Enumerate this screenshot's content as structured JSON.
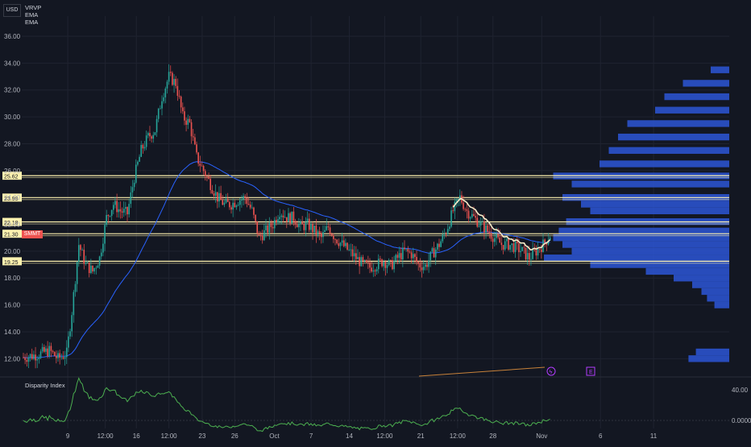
{
  "top_bar": {
    "currency": "USD"
  },
  "indicators": [
    "VRVP",
    "EMA",
    "EMA"
  ],
  "sub_pane": {
    "title": "Disparity Index",
    "ticks": [
      "40.00",
      "0.0000"
    ]
  },
  "colors": {
    "bg": "#131722",
    "grid": "#1f2330",
    "up": "#26a69a",
    "down": "#ef5350",
    "ema_long": "#2962ff",
    "ema_short": "#f5ecc9",
    "level": "#fff3b0",
    "profile": "#2d56d6",
    "disparity_up": "#4caf50",
    "disparity_down": "#ef5350",
    "trend": "#c8823a",
    "event": "#b33cff"
  },
  "badges": {
    "ticker": "SMMT",
    "lightning": "ϟ",
    "earnings": "E"
  },
  "y_axis": {
    "ticks": [
      "36.00",
      "34.00",
      "32.00",
      "30.00",
      "28.00",
      "26.00",
      "24.00",
      "22.00",
      "20.00",
      "18.00",
      "16.00",
      "14.00",
      "12.00"
    ],
    "values": [
      36,
      34,
      32,
      30,
      28,
      26,
      24,
      22,
      20,
      18,
      16,
      14,
      12
    ],
    "ylim": [
      11,
      37.5
    ]
  },
  "x_axis": {
    "ticks": [
      "9",
      "12:00",
      "16",
      "12:00",
      "23",
      "26",
      "Oct",
      "7",
      "14",
      "12:00",
      "21",
      "12:00",
      "28",
      "Nov",
      "6",
      "11"
    ],
    "positions": [
      0.065,
      0.118,
      0.162,
      0.208,
      0.255,
      0.301,
      0.357,
      0.409,
      0.463,
      0.513,
      0.564,
      0.616,
      0.666,
      0.735,
      0.818,
      0.893
    ]
  },
  "price_levels": [
    {
      "label": "25.62",
      "value": 25.62
    },
    {
      "label": "23.99",
      "value": 23.99
    },
    {
      "label": "22.18",
      "value": 22.18
    },
    {
      "label": "21.30",
      "value": 21.3
    },
    {
      "label": "19.25",
      "value": 19.25
    }
  ],
  "chart_data": {
    "type": "candlestick",
    "y_range": [
      11,
      37.5
    ],
    "price_path": [
      [
        0,
        12.1
      ],
      [
        8,
        12.3
      ],
      [
        15,
        12.6
      ],
      [
        20,
        12.0
      ],
      [
        25,
        12.4
      ],
      [
        28,
        15.5
      ],
      [
        32,
        20.5
      ],
      [
        36,
        19.0
      ],
      [
        40,
        18.5
      ],
      [
        44,
        19.5
      ],
      [
        48,
        22.5
      ],
      [
        52,
        23.5
      ],
      [
        56,
        23.0
      ],
      [
        60,
        22.8
      ],
      [
        64,
        25.5
      ],
      [
        68,
        27.5
      ],
      [
        72,
        28.5
      ],
      [
        76,
        29.0
      ],
      [
        80,
        31.5
      ],
      [
        84,
        33.0
      ],
      [
        88,
        32.5
      ],
      [
        92,
        30.0
      ],
      [
        96,
        29.5
      ],
      [
        100,
        27.0
      ],
      [
        104,
        26.0
      ],
      [
        108,
        25.0
      ],
      [
        112,
        24.0
      ],
      [
        116,
        23.5
      ],
      [
        120,
        23.5
      ],
      [
        124,
        23.8
      ],
      [
        128,
        24.0
      ],
      [
        132,
        23.0
      ],
      [
        136,
        21.0
      ],
      [
        140,
        21.5
      ],
      [
        144,
        22.0
      ],
      [
        148,
        23.0
      ],
      [
        152,
        22.5
      ],
      [
        156,
        22.5
      ],
      [
        160,
        21.8
      ],
      [
        164,
        22.0
      ],
      [
        168,
        21.5
      ],
      [
        172,
        21.0
      ],
      [
        176,
        21.8
      ],
      [
        180,
        21.0
      ],
      [
        184,
        20.5
      ],
      [
        188,
        20.0
      ],
      [
        192,
        19.5
      ],
      [
        196,
        19.0
      ],
      [
        200,
        18.8
      ],
      [
        204,
        19.0
      ],
      [
        208,
        19.3
      ],
      [
        212,
        18.9
      ],
      [
        216,
        19.5
      ],
      [
        220,
        20.0
      ],
      [
        224,
        19.8
      ],
      [
        228,
        19.0
      ],
      [
        232,
        18.9
      ],
      [
        236,
        19.8
      ],
      [
        240,
        20.5
      ],
      [
        244,
        21.5
      ],
      [
        248,
        23.0
      ],
      [
        252,
        24.0
      ],
      [
        256,
        23.0
      ],
      [
        260,
        22.5
      ],
      [
        264,
        22.0
      ],
      [
        268,
        21.5
      ],
      [
        272,
        21.0
      ],
      [
        276,
        20.5
      ],
      [
        280,
        20.5
      ],
      [
        284,
        20.3
      ],
      [
        288,
        20.0
      ],
      [
        292,
        19.5
      ],
      [
        296,
        20.0
      ],
      [
        300,
        20.5
      ],
      [
        304,
        21.2
      ]
    ],
    "volume_profile": [
      {
        "price": 33.5,
        "size": 0.1
      },
      {
        "price": 32.5,
        "size": 0.25
      },
      {
        "price": 31.5,
        "size": 0.35
      },
      {
        "price": 30.5,
        "size": 0.4
      },
      {
        "price": 29.5,
        "size": 0.55
      },
      {
        "price": 28.5,
        "size": 0.6
      },
      {
        "price": 27.5,
        "size": 0.65
      },
      {
        "price": 26.5,
        "size": 0.7
      },
      {
        "price": 25.6,
        "size": 0.95
      },
      {
        "price": 25.0,
        "size": 0.85
      },
      {
        "price": 24.0,
        "size": 0.9
      },
      {
        "price": 23.5,
        "size": 0.8
      },
      {
        "price": 23.0,
        "size": 0.75
      },
      {
        "price": 22.2,
        "size": 0.88
      },
      {
        "price": 21.5,
        "size": 0.92
      },
      {
        "price": 21.0,
        "size": 0.95
      },
      {
        "price": 20.5,
        "size": 0.9
      },
      {
        "price": 20.0,
        "size": 0.85
      },
      {
        "price": 19.5,
        "size": 1.0
      },
      {
        "price": 19.0,
        "size": 0.75
      },
      {
        "price": 18.5,
        "size": 0.45
      },
      {
        "price": 18.0,
        "size": 0.3
      },
      {
        "price": 17.5,
        "size": 0.2
      },
      {
        "price": 17.0,
        "size": 0.15
      },
      {
        "price": 16.5,
        "size": 0.12
      },
      {
        "price": 16.0,
        "size": 0.08
      },
      {
        "price": 12.5,
        "size": 0.18
      },
      {
        "price": 12.0,
        "size": 0.22
      }
    ]
  }
}
